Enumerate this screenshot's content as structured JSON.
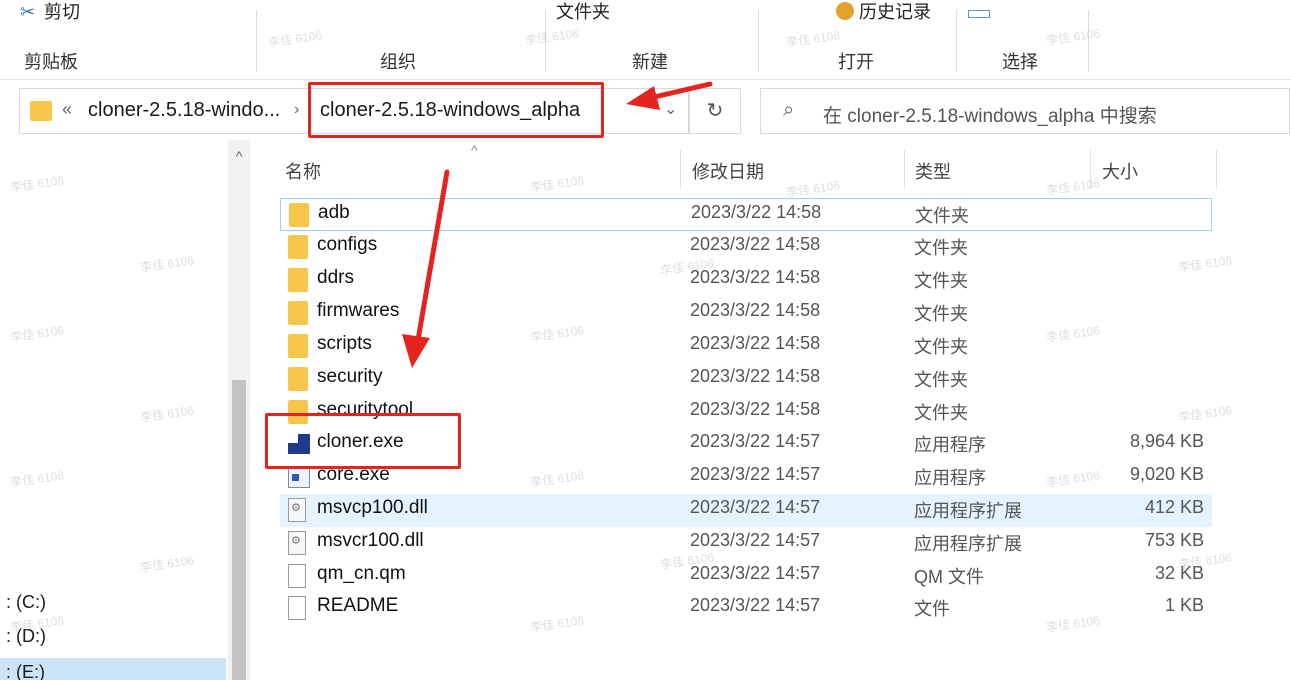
{
  "ribbon": {
    "cut_label": "剪切",
    "folder_label": "文件夹",
    "history_label": "历史记录",
    "groups": [
      "剪贴板",
      "组织",
      "新建",
      "打开",
      "选择"
    ]
  },
  "address": {
    "crumb1": "cloner-2.5.18-windo...",
    "crumb2": "cloner-2.5.18-windows_alpha",
    "search_placeholder": "在 cloner-2.5.18-windows_alpha 中搜索"
  },
  "columns": [
    "名称",
    "修改日期",
    "类型",
    "大小"
  ],
  "files": [
    {
      "name": "adb",
      "date": "2023/3/22 14:58",
      "type": "文件夹",
      "size": "",
      "icon": "folder"
    },
    {
      "name": "configs",
      "date": "2023/3/22 14:58",
      "type": "文件夹",
      "size": "",
      "icon": "folder"
    },
    {
      "name": "ddrs",
      "date": "2023/3/22 14:58",
      "type": "文件夹",
      "size": "",
      "icon": "folder"
    },
    {
      "name": "firmwares",
      "date": "2023/3/22 14:58",
      "type": "文件夹",
      "size": "",
      "icon": "folder"
    },
    {
      "name": "scripts",
      "date": "2023/3/22 14:58",
      "type": "文件夹",
      "size": "",
      "icon": "folder"
    },
    {
      "name": "security",
      "date": "2023/3/22 14:58",
      "type": "文件夹",
      "size": "",
      "icon": "folder"
    },
    {
      "name": "securitytool",
      "date": "2023/3/22 14:58",
      "type": "文件夹",
      "size": "",
      "icon": "folder"
    },
    {
      "name": "cloner.exe",
      "date": "2023/3/22 14:57",
      "type": "应用程序",
      "size": "8,964 KB",
      "icon": "cloner-app"
    },
    {
      "name": "core.exe",
      "date": "2023/3/22 14:57",
      "type": "应用程序",
      "size": "9,020 KB",
      "icon": "app"
    },
    {
      "name": "msvcp100.dll",
      "date": "2023/3/22 14:57",
      "type": "应用程序扩展",
      "size": "412 KB",
      "icon": "dll"
    },
    {
      "name": "msvcr100.dll",
      "date": "2023/3/22 14:57",
      "type": "应用程序扩展",
      "size": "753 KB",
      "icon": "dll"
    },
    {
      "name": "qm_cn.qm",
      "date": "2023/3/22 14:57",
      "type": "QM 文件",
      "size": "32 KB",
      "icon": "document"
    },
    {
      "name": "README",
      "date": "2023/3/22 14:57",
      "type": "文件",
      "size": "1 KB",
      "icon": "document"
    }
  ],
  "nav": {
    "drives": [
      ": (C:)",
      ": (D:)",
      ": (E:)"
    ]
  },
  "watermark": "李佳 6106",
  "colors": {
    "annotation": "#e5231f",
    "folder": "#f5c64a",
    "selection": "#e5f3ff"
  }
}
